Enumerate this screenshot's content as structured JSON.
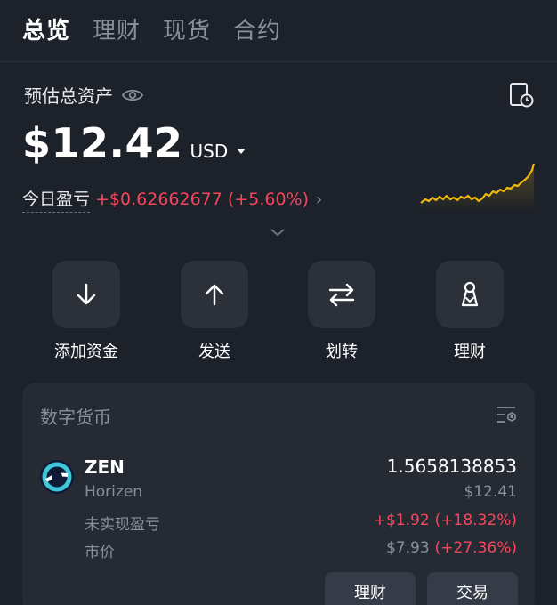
{
  "tabs": [
    {
      "label": "总览",
      "active": true
    },
    {
      "label": "理财",
      "active": false
    },
    {
      "label": "现货",
      "active": false
    },
    {
      "label": "合约",
      "active": false
    }
  ],
  "overview": {
    "asset_label": "预估总资产",
    "balance": "$12.42",
    "currency": "USD",
    "pnl_label": "今日盈亏",
    "pnl_value": "+$0.62662677 (+5.60%)"
  },
  "actions": [
    {
      "label": "添加资金",
      "icon": "arrow-down-icon"
    },
    {
      "label": "发送",
      "icon": "arrow-up-icon"
    },
    {
      "label": "划转",
      "icon": "transfer-icon"
    },
    {
      "label": "理财",
      "icon": "earn-icon"
    }
  ],
  "crypto": {
    "section_title": "数字货币",
    "coin": {
      "symbol": "ZEN",
      "name": "Horizen",
      "quantity": "1.5658138853",
      "value": "$12.41",
      "unrealized_label": "未实现盈亏",
      "unrealized_amount": "+$1.92",
      "unrealized_pct": "(+18.32%)",
      "price_label": "市价",
      "price": "$7.93",
      "price_pct": "(+27.36%)"
    },
    "buttons": {
      "earn": "理财",
      "trade": "交易"
    }
  },
  "colors": {
    "background": "#1d2129",
    "card": "#252a33",
    "negative_red": "#f6465d",
    "sparkline": "#f0b90b"
  }
}
